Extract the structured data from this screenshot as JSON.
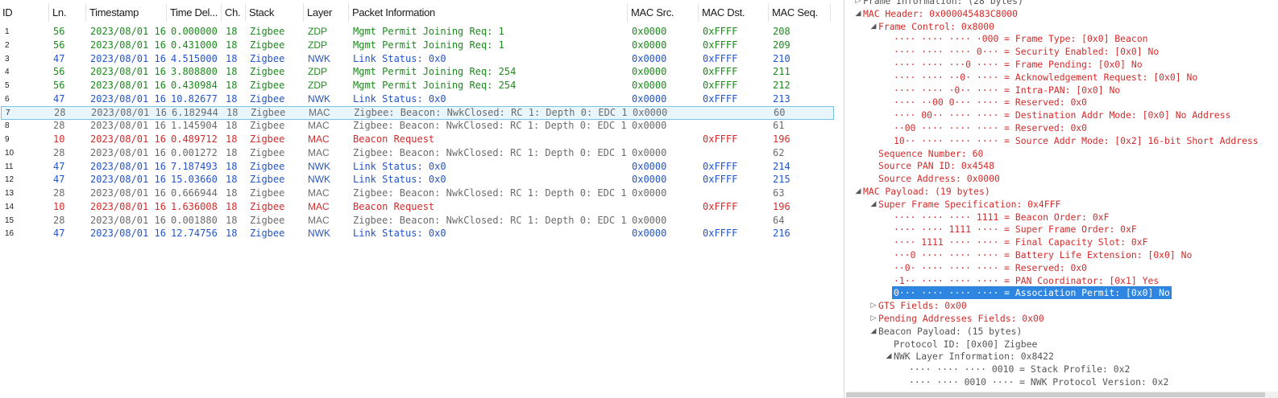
{
  "packet_table": {
    "columns": [
      "ID",
      "Ln.",
      "Timestamp",
      "Time Del...",
      "Ch.",
      "Stack",
      "Layer",
      "Packet Information",
      "MAC Src.",
      "MAC Dst.",
      "MAC Seq."
    ],
    "rows": [
      {
        "id": "1",
        "ln": "56",
        "ts": "2023/08/01 16",
        "td": "0.000000",
        "ch": "18",
        "stack": "Zigbee",
        "layer": "ZDP",
        "info": "Mgmt Permit Joining Req: 1",
        "src": "0x0000",
        "dst": "0xFFFF",
        "seq": "208",
        "color": "#1c8a1c"
      },
      {
        "id": "2",
        "ln": "56",
        "ts": "2023/08/01 16",
        "td": "0.431000",
        "ch": "18",
        "stack": "Zigbee",
        "layer": "ZDP",
        "info": "Mgmt Permit Joining Req: 1",
        "src": "0x0000",
        "dst": "0xFFFF",
        "seq": "209",
        "color": "#1c8a1c"
      },
      {
        "id": "3",
        "ln": "47",
        "ts": "2023/08/01 16",
        "td": "4.515000",
        "ch": "18",
        "stack": "Zigbee",
        "layer": "NWK",
        "info": "Link Status: 0x0",
        "src": "0x0000",
        "dst": "0xFFFF",
        "seq": "210",
        "color": "#2255c9"
      },
      {
        "id": "4",
        "ln": "56",
        "ts": "2023/08/01 16",
        "td": "3.808800",
        "ch": "18",
        "stack": "Zigbee",
        "layer": "ZDP",
        "info": "Mgmt Permit Joining Req: 254",
        "src": "0x0000",
        "dst": "0xFFFF",
        "seq": "211",
        "color": "#1c8a1c"
      },
      {
        "id": "5",
        "ln": "56",
        "ts": "2023/08/01 16",
        "td": "0.430984",
        "ch": "18",
        "stack": "Zigbee",
        "layer": "ZDP",
        "info": "Mgmt Permit Joining Req: 254",
        "src": "0x0000",
        "dst": "0xFFFF",
        "seq": "212",
        "color": "#1c8a1c"
      },
      {
        "id": "6",
        "ln": "47",
        "ts": "2023/08/01 16",
        "td": "10.82677",
        "ch": "18",
        "stack": "Zigbee",
        "layer": "NWK",
        "info": "Link Status: 0x0",
        "src": "0x0000",
        "dst": "0xFFFF",
        "seq": "213",
        "color": "#2255c9"
      },
      {
        "id": "7",
        "ln": "28",
        "ts": "2023/08/01 16",
        "td": "6.182944",
        "ch": "18",
        "stack": "Zigbee",
        "layer": "MAC",
        "info": "Zigbee: Beacon: NwkClosed: RC 1: Depth 0: EDC 1…",
        "src": "0x0000",
        "dst": "",
        "seq": "60",
        "color": "#6b6b6b",
        "selected": true
      },
      {
        "id": "8",
        "ln": "28",
        "ts": "2023/08/01 16",
        "td": "1.145904",
        "ch": "18",
        "stack": "Zigbee",
        "layer": "MAC",
        "info": "Zigbee: Beacon: NwkClosed: RC 1: Depth 0: EDC 1…",
        "src": "0x0000",
        "dst": "",
        "seq": "61",
        "color": "#6b6b6b"
      },
      {
        "id": "9",
        "ln": "10",
        "ts": "2023/08/01 16",
        "td": "0.489712",
        "ch": "18",
        "stack": "Zigbee",
        "layer": "MAC",
        "info": "Beacon Request",
        "src": "",
        "dst": "0xFFFF",
        "seq": "196",
        "color": "#d42a2a"
      },
      {
        "id": "10",
        "ln": "28",
        "ts": "2023/08/01 16",
        "td": "0.001272",
        "ch": "18",
        "stack": "Zigbee",
        "layer": "MAC",
        "info": "Zigbee: Beacon: NwkClosed: RC 1: Depth 0: EDC 1…",
        "src": "0x0000",
        "dst": "",
        "seq": "62",
        "color": "#6b6b6b"
      },
      {
        "id": "11",
        "ln": "47",
        "ts": "2023/08/01 16",
        "td": "7.187493",
        "ch": "18",
        "stack": "Zigbee",
        "layer": "NWK",
        "info": "Link Status: 0x0",
        "src": "0x0000",
        "dst": "0xFFFF",
        "seq": "214",
        "color": "#2255c9"
      },
      {
        "id": "12",
        "ln": "47",
        "ts": "2023/08/01 16",
        "td": "15.03660",
        "ch": "18",
        "stack": "Zigbee",
        "layer": "NWK",
        "info": "Link Status: 0x0",
        "src": "0x0000",
        "dst": "0xFFFF",
        "seq": "215",
        "color": "#2255c9"
      },
      {
        "id": "13",
        "ln": "28",
        "ts": "2023/08/01 16",
        "td": "0.666944",
        "ch": "18",
        "stack": "Zigbee",
        "layer": "MAC",
        "info": "Zigbee: Beacon: NwkClosed: RC 1: Depth 0: EDC 1…",
        "src": "0x0000",
        "dst": "",
        "seq": "63",
        "color": "#6b6b6b"
      },
      {
        "id": "14",
        "ln": "10",
        "ts": "2023/08/01 16",
        "td": "1.636008",
        "ch": "18",
        "stack": "Zigbee",
        "layer": "MAC",
        "info": "Beacon Request",
        "src": "",
        "dst": "0xFFFF",
        "seq": "196",
        "color": "#d42a2a"
      },
      {
        "id": "15",
        "ln": "28",
        "ts": "2023/08/01 16",
        "td": "0.001880",
        "ch": "18",
        "stack": "Zigbee",
        "layer": "MAC",
        "info": "Zigbee: Beacon: NwkClosed: RC 1: Depth 0: EDC 1…",
        "src": "0x0000",
        "dst": "",
        "seq": "64",
        "color": "#6b6b6b"
      },
      {
        "id": "16",
        "ln": "47",
        "ts": "2023/08/01 16",
        "td": "12.74756",
        "ch": "18",
        "stack": "Zigbee",
        "layer": "NWK",
        "info": "Link Status: 0x0",
        "src": "0x0000",
        "dst": "0xFFFF",
        "seq": "216",
        "color": "#2255c9"
      }
    ]
  },
  "detail_tree": [
    {
      "text": "Frame Information: (28 bytes)",
      "depth": 0,
      "toggle": "collapsed",
      "color": "gray"
    },
    {
      "text": "MAC Header: 0x000045483C8000",
      "depth": 0,
      "toggle": "expanded"
    },
    {
      "text": "Frame Control: 0x8000",
      "depth": 1,
      "toggle": "expanded"
    },
    {
      "text": "···· ···· ···· ·000 = Frame Type: [0x0] Beacon",
      "depth": 2
    },
    {
      "text": "···· ···· ···· 0··· = Security Enabled: [0x0] No",
      "depth": 2
    },
    {
      "text": "···· ···· ···0 ···· = Frame Pending: [0x0] No",
      "depth": 2
    },
    {
      "text": "···· ···· ··0· ···· = Acknowledgement Request: [0x0] No",
      "depth": 2
    },
    {
      "text": "···· ···· ·0·· ···· = Intra-PAN: [0x0] No",
      "depth": 2
    },
    {
      "text": "···· ··00 0··· ···· = Reserved: 0x0",
      "depth": 2
    },
    {
      "text": "···· 00·· ···· ···· = Destination Addr Mode: [0x0] No Address",
      "depth": 2
    },
    {
      "text": "··00 ···· ···· ···· = Reserved: 0x0",
      "depth": 2
    },
    {
      "text": "10·· ···· ···· ···· = Source Addr Mode: [0x2] 16-bit Short Address",
      "depth": 2
    },
    {
      "text": "Sequence Number: 60",
      "depth": 1
    },
    {
      "text": "Source PAN ID: 0x4548",
      "depth": 1
    },
    {
      "text": "Source Address: 0x0000",
      "depth": 1
    },
    {
      "text": "MAC Payload: (19 bytes)",
      "depth": 0,
      "toggle": "expanded"
    },
    {
      "text": "Super Frame Specification: 0x4FFF",
      "depth": 1,
      "toggle": "expanded"
    },
    {
      "text": "···· ···· ···· 1111 = Beacon Order: 0xF",
      "depth": 2
    },
    {
      "text": "···· ···· 1111 ···· = Super Frame Order: 0xF",
      "depth": 2
    },
    {
      "text": "···· 1111 ···· ···· = Final Capacity Slot: 0xF",
      "depth": 2
    },
    {
      "text": "···0 ···· ···· ···· = Battery Life Extension: [0x0] No",
      "depth": 2
    },
    {
      "text": "··0· ···· ···· ···· = Reserved: 0x0",
      "depth": 2
    },
    {
      "text": "·1·· ···· ···· ···· = PAN Coordinator: [0x1] Yes",
      "depth": 2
    },
    {
      "text": "0··· ···· ···· ···· = Association Permit: [0x0] No",
      "depth": 2,
      "highlight": true
    },
    {
      "text": "GTS Fields: 0x00",
      "depth": 1,
      "toggle": "collapsed"
    },
    {
      "text": "Pending Addresses Fields: 0x00",
      "depth": 1,
      "toggle": "collapsed"
    },
    {
      "text": "Beacon Payload: (15 bytes)",
      "depth": 1,
      "toggle": "expanded",
      "color": "gray"
    },
    {
      "text": "Protocol ID: [0x00] Zigbee",
      "depth": 2,
      "color": "gray"
    },
    {
      "text": "NWK Layer Information: 0x8422",
      "depth": 2,
      "toggle": "expanded",
      "color": "gray"
    },
    {
      "text": "···· ···· ···· 0010 = Stack Profile: 0x2",
      "depth": 3,
      "color": "gray"
    },
    {
      "text": "···· ···· 0010 ···· = NWK Protocol Version: 0x2",
      "depth": 3,
      "color": "gray"
    }
  ]
}
